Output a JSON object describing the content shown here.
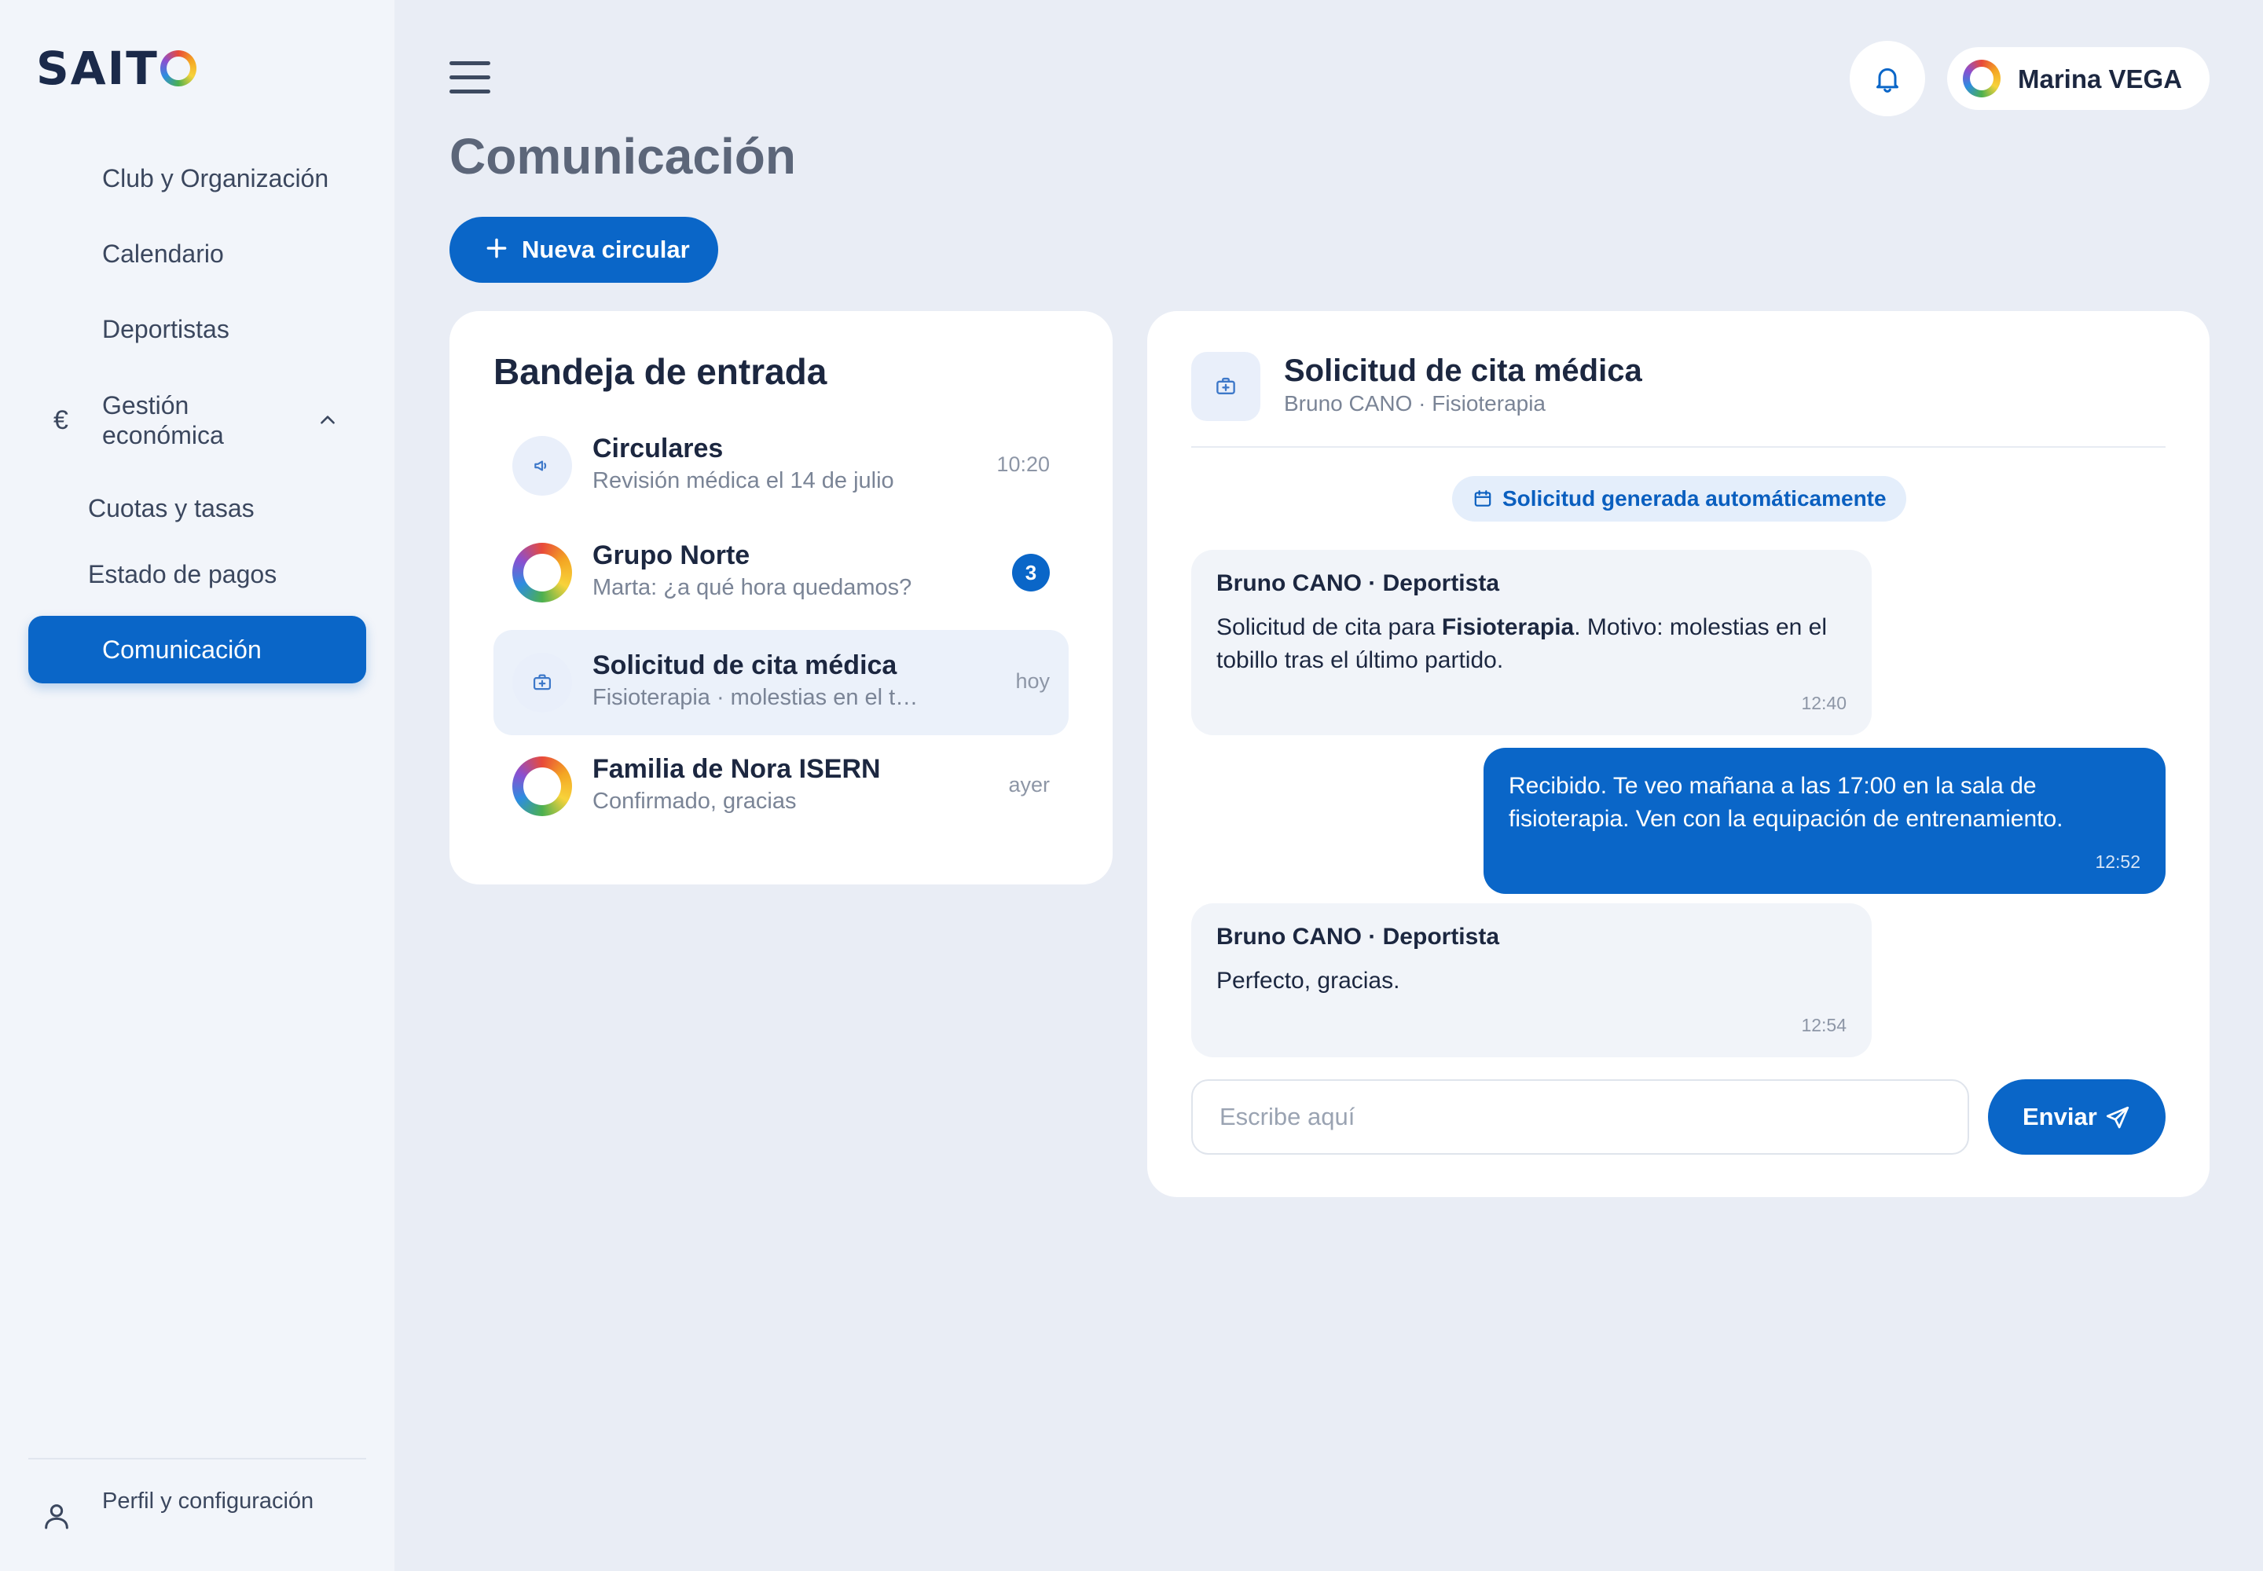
{
  "app": {
    "logo_text": "SAIT",
    "logo_ring": "O"
  },
  "sidebar": {
    "items": [
      {
        "label": "Club y Organización"
      },
      {
        "label": "Calendario"
      },
      {
        "label": "Deportistas"
      },
      {
        "label": "Gestión económica",
        "icon": "euro-icon",
        "expanded": true
      },
      {
        "label": "Cuotas y tasas"
      },
      {
        "label": "Estado de pagos"
      },
      {
        "label": "Comunicación",
        "active": true
      }
    ],
    "profile_label": "Perfil y configuración"
  },
  "header": {
    "user_name": "Marina VEGA",
    "page_title": "Comunicación",
    "new_button_label": "Nueva circular"
  },
  "inbox": {
    "title": "Bandeja de entrada",
    "conversations": [
      {
        "name": "Circulares",
        "preview": "Revisión médica el 14 de julio",
        "time": "10:20",
        "icon": "megaphone-icon"
      },
      {
        "name": "Grupo Norte",
        "preview": "Marta: ¿a qué hora quedamos?",
        "badge": "3",
        "icon": "avatar"
      },
      {
        "name": "Solicitud de cita médica",
        "preview": "Fisioterapia · molestias en el to...",
        "time": "hoy",
        "icon": "medical-kit-icon",
        "selected": true
      },
      {
        "name": "Familia de Nora ISERN",
        "preview": "Confirmado, gracias",
        "time": "ayer",
        "icon": "avatar"
      }
    ]
  },
  "chat": {
    "title": "Solicitud de cita médica",
    "subtitle": "Bruno CANO · Fisioterapia",
    "auto_notice": "Solicitud generada automáticamente",
    "messages": [
      {
        "sender": "Bruno CANO · Deportista",
        "text_before": "Solicitud de cita para ",
        "text_bold": "Fisioterapia",
        "text_after": ". Motivo: molestias en el tobillo tras el último partido.",
        "time": "12:40",
        "direction": "in"
      },
      {
        "text": "Recibido. Te veo mañana a las 17:00 en la sala de fisioterapia. Ven con la equipación de entrenamiento.",
        "time": "12:52",
        "direction": "out"
      },
      {
        "sender": "Bruno CANO · Deportista",
        "text": "Perfecto, gracias.",
        "time": "12:54",
        "direction": "in"
      }
    ],
    "composer_placeholder": "Escribe aquí",
    "send_label": "Enviar"
  },
  "colors": {
    "accent": "#0a66c8",
    "background": "#e9edf5",
    "sidebar": "#f2f5fa",
    "text": "#1c2740"
  }
}
